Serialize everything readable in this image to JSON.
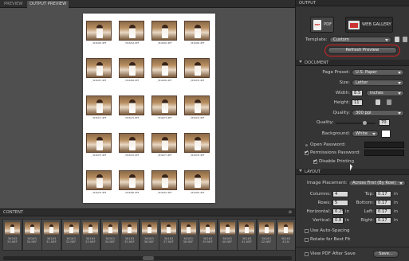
{
  "tabs": [
    "Preview",
    "Output Preview"
  ],
  "sheet": {
    "rows": 5,
    "cols": 4,
    "captions": [
      "_3K16263.NEF",
      "_3K16264.NEF",
      "_3K16265.NEF",
      "_3K16266.NEF",
      "_3K16267.NEF",
      "_3K16268.NEF",
      "_3K16269.NEF",
      "_3K16270.NEF",
      "_3K16271.NEF",
      "_3K16272.NEF",
      "_3K16273.NEF",
      "_3K16274.NEF",
      "_3K16275.NEF",
      "_3K16276.NEF",
      "_3K16277.NEF",
      "_3K16278.NEF",
      "_3K16279.NEF",
      "_3K16280.NEF",
      "_3K16281.NEF",
      "_3K16282.NEF"
    ]
  },
  "content": {
    "title": "Content",
    "menu_icon": "⊕",
    "frames": [
      "3K163\n29.NEF",
      "3K163\n30.NEF",
      "3K163\n31.NEF",
      "3K163\n32.NEF",
      "3K163\n33.NEF",
      "3K163\n34.NEF",
      "3K163\n35.NEF",
      "3K163\n36.NEF",
      "3K163\n37.NEF",
      "3K163\n38.NEF",
      "3K163\n39.NEF",
      "3K163\n40.NEF",
      "3K163\n41.NEF",
      "3K163\n42.NEF",
      "3K163\n43.N"
    ]
  },
  "output": {
    "header": "Output",
    "pdf_label": "PDF",
    "web_label": "WEB GALLERY",
    "template_label": "Template:",
    "template_value": "Custom",
    "refresh_label": "Refresh Preview"
  },
  "document": {
    "header": "Document",
    "page_preset_label": "Page Preset:",
    "page_preset_value": "U.S. Paper",
    "size_label": "Size:",
    "size_value": "Letter",
    "width_label": "Width:",
    "width_value": "8.5",
    "units_value": "inches",
    "height_label": "Height:",
    "height_value": "11",
    "quality_label": "Quality:",
    "quality_value": "300 ppi",
    "quality2_label": "Quality:",
    "quality2_value": "70",
    "background_label": "Background:",
    "background_value": "White",
    "background_swatch": "#ffffff",
    "open_password_label": "Open Password:",
    "permissions_label": "Permissions Password:",
    "disable_printing_label": "Disable Printing"
  },
  "layout": {
    "header": "Layout",
    "placement_label": "Image Placement:",
    "placement_value": "Across First (By Row)",
    "columns_label": "Columns:",
    "columns_value": "4",
    "rows_label": "Rows:",
    "rows_value": "5",
    "horizontal_label": "Horizontal:",
    "horizontal_value": "0.25",
    "vertical_label": "Vertical:",
    "vertical_value": "0.8",
    "top_label": "Top:",
    "top_value": "0.17",
    "bottom_label": "Bottom:",
    "bottom_value": "0.17",
    "left_label": "Left:",
    "left_value": "0.17",
    "right_label": "Right:",
    "right_value": "0.17",
    "unit": "in",
    "auto_spacing_label": "Use Auto-Spacing",
    "rotate_label": "Rotate for Best Fit",
    "view_pdf_label": "View PDF After Save",
    "save_label": "Save..."
  },
  "colors": {
    "accent_ring": "#d62020"
  }
}
